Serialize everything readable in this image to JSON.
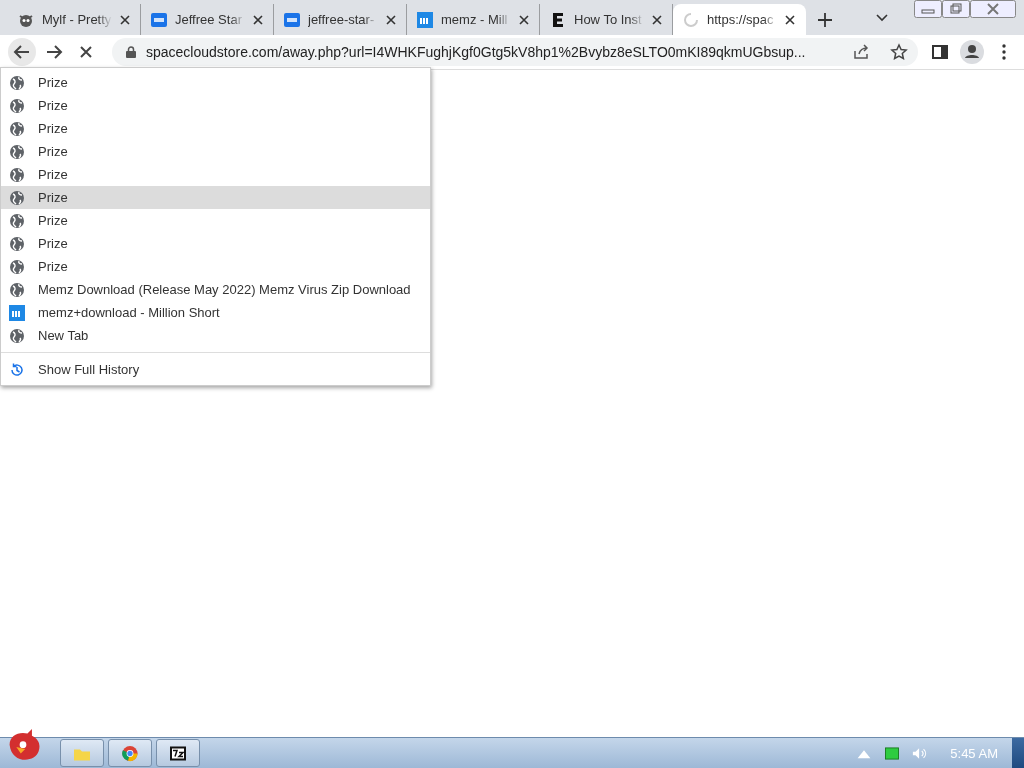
{
  "tabs": [
    {
      "title": "Mylf - Pretty",
      "kind": "cat",
      "selected": false
    },
    {
      "title": "Jeffree Star",
      "kind": "gif",
      "selected": false
    },
    {
      "title": "jeffree-star-",
      "kind": "gif",
      "selected": false
    },
    {
      "title": "memz - Mill",
      "kind": "m",
      "selected": false
    },
    {
      "title": "How To Inst",
      "kind": "e",
      "selected": false
    },
    {
      "title": "https://spac",
      "kind": "spinner",
      "selected": true
    }
  ],
  "address": {
    "url": "spacecloudstore.com/away.php?url=I4WHKFughjKgf0Gtg5kV8hp1%2Bvybz8eSLTO0mKI89qkmUGbsup..."
  },
  "history_menu": {
    "items": [
      {
        "label": "Prize",
        "kind": "globe",
        "selected": false
      },
      {
        "label": "Prize",
        "kind": "globe",
        "selected": false
      },
      {
        "label": "Prize",
        "kind": "globe",
        "selected": false
      },
      {
        "label": "Prize",
        "kind": "globe",
        "selected": false
      },
      {
        "label": "Prize",
        "kind": "globe",
        "selected": false
      },
      {
        "label": "Prize",
        "kind": "globe",
        "selected": true
      },
      {
        "label": "Prize",
        "kind": "globe",
        "selected": false
      },
      {
        "label": "Prize",
        "kind": "globe",
        "selected": false
      },
      {
        "label": "Prize",
        "kind": "globe",
        "selected": false
      },
      {
        "label": "Memz Download (Release May 2022) Memz Virus Zip Download",
        "kind": "globe",
        "selected": false
      },
      {
        "label": "memz+download - Million Short",
        "kind": "m",
        "selected": false
      },
      {
        "label": "New Tab",
        "kind": "globe",
        "selected": false
      }
    ],
    "footer": "Show Full History"
  },
  "taskbar": {
    "clock": "5:45 AM"
  }
}
